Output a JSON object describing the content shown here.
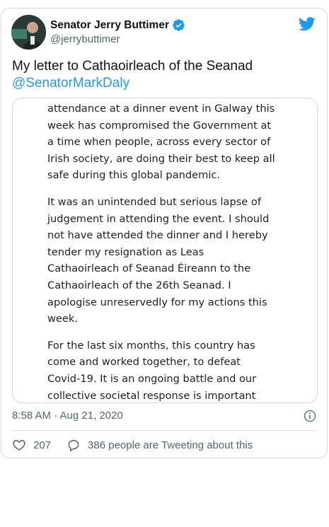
{
  "author": {
    "name": "Senator Jerry Buttimer",
    "handle": "@jerrybuttimer"
  },
  "tweet": {
    "text": "My letter to Cathaoirleach of the Seanad",
    "mention": "@SenatorMarkDaly"
  },
  "media": {
    "paragraphs": [
      "attendance at a dinner event in Galway this\nweek has compromised the Government at\na time when people, across every sector of\nIrish society, are doing their best to keep all\nsafe during this global pandemic.",
      "It was an unintended but serious lapse of\njudgement in attending the event. I should\nnot have attended the dinner and I hereby\ntender my resignation as Leas\nCathaoirleach of Seanad Éireann to the\nCathaoirleach of the 26th Seanad. I\napologise unreservedly for my actions this\nweek.",
      "For the last six months, this country has\ncome and worked together, to defeat\nCovid-19. It is an ongoing battle and our\ncollective societal response is important"
    ]
  },
  "meta": {
    "timestamp": "8:58 AM · Aug 21, 2020"
  },
  "actions": {
    "likes": "207",
    "replies_text": "386 people are Tweeting about this"
  },
  "colors": {
    "accent": "#1d9bf0",
    "secondary_text": "#536471",
    "border": "#cfd9de"
  }
}
